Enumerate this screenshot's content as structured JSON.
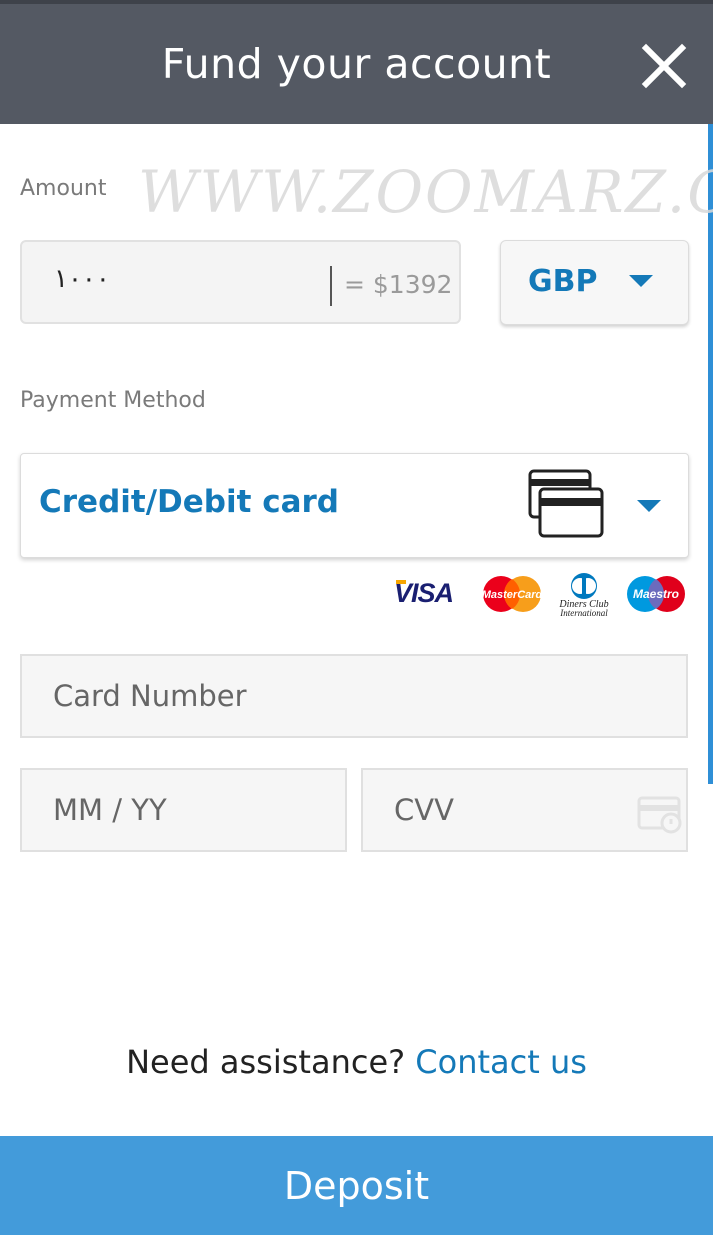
{
  "header": {
    "title": "Fund your account",
    "close_icon": "close-icon"
  },
  "watermark": "WWW.ZOOMARZ.COM",
  "amount": {
    "label": "Amount",
    "value": "١٠٠٠",
    "converted": "= $1392"
  },
  "currency": {
    "selected": "GBP",
    "icon": "chevron-down-icon"
  },
  "payment_method": {
    "label": "Payment Method",
    "selected": "Credit/Debit card",
    "icon": "credit-cards-icon"
  },
  "card_logos": {
    "visa": "VISA",
    "mastercard": "MasterCard",
    "diners_line1": "Diners Club",
    "diners_line2": "International",
    "maestro": "Maestro"
  },
  "fields": {
    "card_number_placeholder": "Card Number",
    "expiry_placeholder": "MM / YY",
    "cvv_placeholder": "CVV"
  },
  "assistance": {
    "text": "Need assistance?",
    "link": "Contact us"
  },
  "deposit": {
    "label": "Deposit"
  },
  "colors": {
    "header_bg": "#545963",
    "accent": "#1479b8",
    "deposit_bg": "#439bda"
  }
}
